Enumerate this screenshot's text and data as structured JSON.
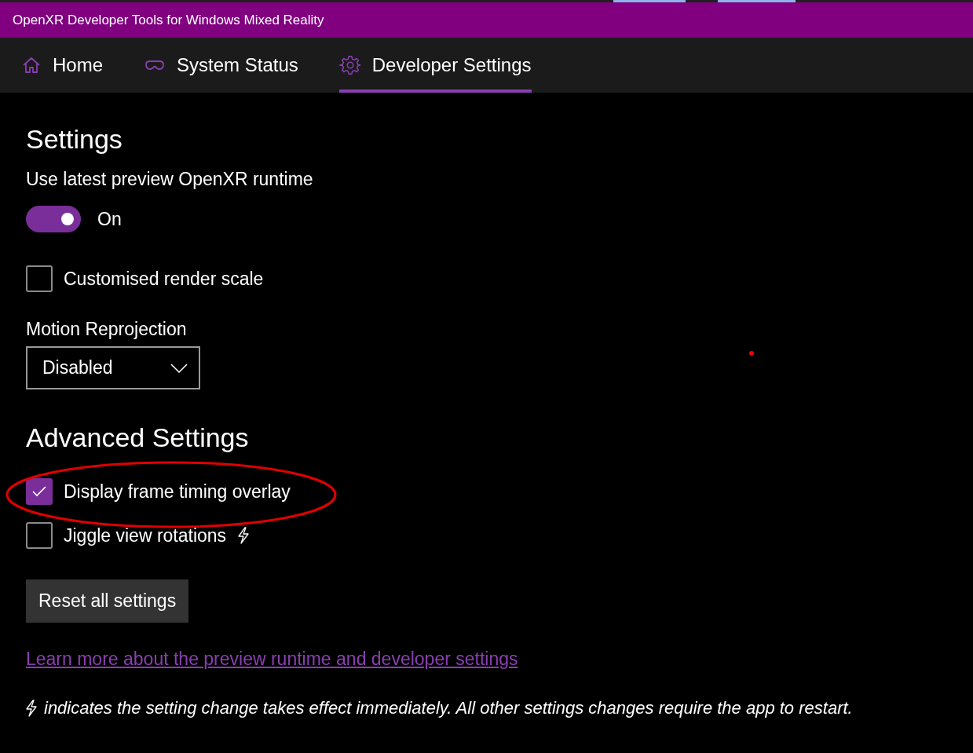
{
  "window": {
    "title": "OpenXR Developer Tools for Windows Mixed Reality"
  },
  "nav": [
    {
      "label": "Home",
      "selected": false
    },
    {
      "label": "System Status",
      "selected": false
    },
    {
      "label": "Developer Settings",
      "selected": true
    }
  ],
  "sections": [
    {
      "title": "Settings",
      "items": [
        {
          "kind": "toggle",
          "label": "Use latest preview OpenXR runtime",
          "on": true,
          "state_text": "On"
        },
        {
          "kind": "checkbox",
          "label": "Customised render scale",
          "checked": false,
          "immediate": false
        },
        {
          "kind": "dropdown",
          "label": "Motion Reprojection",
          "value": "Disabled"
        }
      ]
    },
    {
      "title": "Advanced Settings",
      "items": [
        {
          "kind": "checkbox",
          "label": "Display frame timing overlay",
          "checked": true,
          "immediate": false
        },
        {
          "kind": "checkbox",
          "label": "Jiggle view rotations",
          "checked": false,
          "immediate": true
        }
      ]
    }
  ],
  "reset_button": "Reset all settings",
  "link": "Learn more about the preview runtime and developer settings",
  "note": "indicates the setting change takes effect immediately. All other settings changes require the app to restart."
}
